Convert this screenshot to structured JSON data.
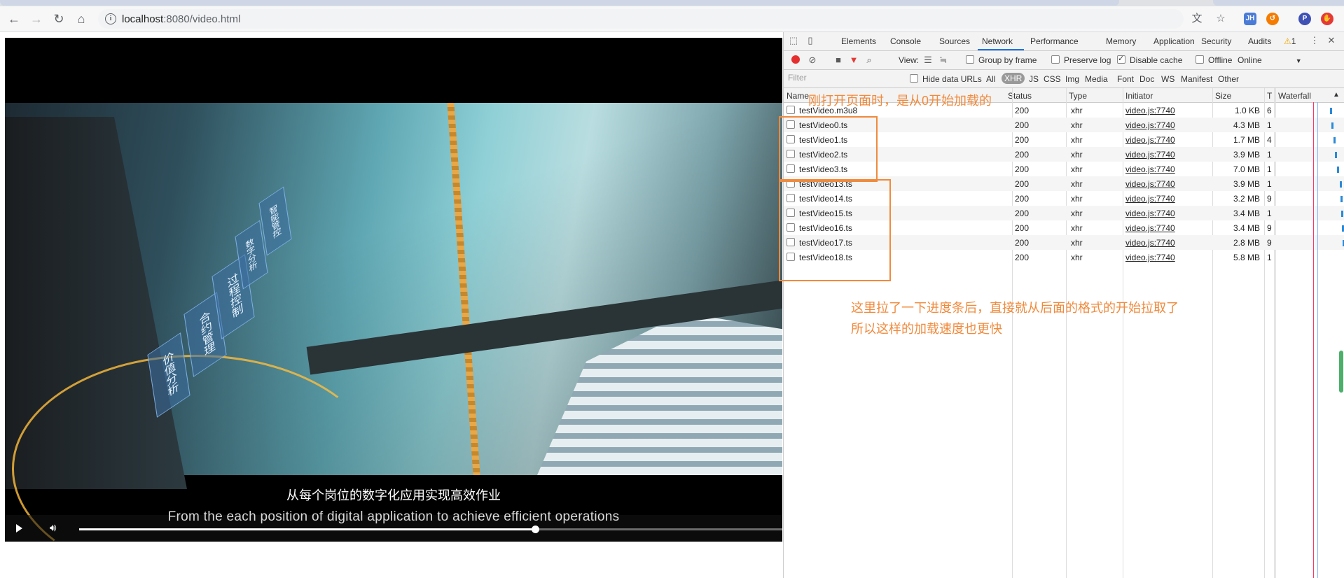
{
  "browser": {
    "url_host": "localhost",
    "url_path": ":8080/video.html",
    "extensions": [
      {
        "name": "translate-icon",
        "label": "",
        "color": "#5f6368"
      },
      {
        "name": "star-icon",
        "label": "",
        "color": "#5f6368"
      },
      {
        "name": "jh-extension-icon",
        "label": "JH",
        "color": "#4a7bd6"
      },
      {
        "name": "refresh-extension-icon",
        "label": "",
        "color": "#f57c00"
      },
      {
        "name": "profile-avatar",
        "label": "P",
        "color": "#3f51b5"
      },
      {
        "name": "stop-extension-icon",
        "label": "",
        "color": "#e53935"
      }
    ]
  },
  "video": {
    "subtitle_cn": "从每个岗位的数字化应用实现高效作业",
    "subtitle_en": "From the each position of digital application to achieve efficient operations",
    "panels": [
      "价值分析",
      "合约管理",
      "过程控制",
      "数字分析",
      "智能管控"
    ],
    "progress": 0.648
  },
  "devtools": {
    "tabs": [
      "Elements",
      "Console",
      "Sources",
      "Network",
      "Performance",
      "Memory",
      "Application",
      "Security",
      "Audits"
    ],
    "active_tab": "Network",
    "warning_count": "1",
    "toolbar": {
      "view_label": "View:",
      "group_by_frame": "Group by frame",
      "preserve_log": "Preserve log",
      "disable_cache": "Disable cache",
      "offline": "Offline",
      "throttle": "Online"
    },
    "filter": {
      "placeholder": "Filter",
      "hide_data_urls": "Hide data URLs",
      "types": [
        "All",
        "XHR",
        "JS",
        "CSS",
        "Img",
        "Media",
        "Font",
        "Doc",
        "WS",
        "Manifest",
        "Other"
      ],
      "active_type": "XHR"
    },
    "columns": [
      "Name",
      "Status",
      "Type",
      "Initiator",
      "Size",
      "T",
      "Waterfall"
    ],
    "requests": [
      {
        "name": "testVideo.m3u8",
        "status": "200",
        "type": "xhr",
        "initiator": "video.js:7740",
        "size": "1.0 KB",
        "time": "6",
        "wf": 0.82
      },
      {
        "name": "testVideo0.ts",
        "status": "200",
        "type": "xhr",
        "initiator": "video.js:7740",
        "size": "4.3 MB",
        "time": "1",
        "wf": 0.84
      },
      {
        "name": "testVideo1.ts",
        "status": "200",
        "type": "xhr",
        "initiator": "video.js:7740",
        "size": "1.7 MB",
        "time": "4",
        "wf": 0.88
      },
      {
        "name": "testVideo2.ts",
        "status": "200",
        "type": "xhr",
        "initiator": "video.js:7740",
        "size": "3.9 MB",
        "time": "1",
        "wf": 0.9
      },
      {
        "name": "testVideo3.ts",
        "status": "200",
        "type": "xhr",
        "initiator": "video.js:7740",
        "size": "7.0 MB",
        "time": "1",
        "wf": 0.93
      },
      {
        "name": "testVideo13.ts",
        "status": "200",
        "type": "xhr",
        "initiator": "video.js:7740",
        "size": "3.9 MB",
        "time": "1",
        "wf": 0.98
      },
      {
        "name": "testVideo14.ts",
        "status": "200",
        "type": "xhr",
        "initiator": "video.js:7740",
        "size": "3.2 MB",
        "time": "9",
        "wf": 0.99
      },
      {
        "name": "testVideo15.ts",
        "status": "200",
        "type": "xhr",
        "initiator": "video.js:7740",
        "size": "3.4 MB",
        "time": "1",
        "wf": 1.0
      },
      {
        "name": "testVideo16.ts",
        "status": "200",
        "type": "xhr",
        "initiator": "video.js:7740",
        "size": "3.4 MB",
        "time": "9",
        "wf": 1.01
      },
      {
        "name": "testVideo17.ts",
        "status": "200",
        "type": "xhr",
        "initiator": "video.js:7740",
        "size": "2.8 MB",
        "time": "9",
        "wf": 1.02
      },
      {
        "name": "testVideo18.ts",
        "status": "200",
        "type": "xhr",
        "initiator": "video.js:7740",
        "size": "5.8 MB",
        "time": "1",
        "wf": 1.04
      }
    ]
  },
  "annotations": {
    "top": "刚打开页面时，是从0开始加载的",
    "bottom_line1": "这里拉了一下进度条后，直接就从后面的格式的开始拉取了",
    "bottom_line2": "所以这样的加载速度也更快",
    "color": "#f08a3c"
  }
}
